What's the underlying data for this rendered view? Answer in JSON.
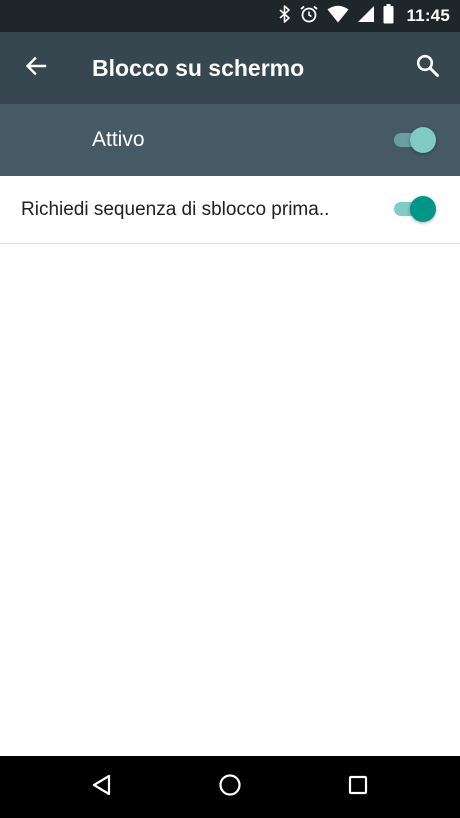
{
  "status_bar": {
    "time": "11:45",
    "icons": [
      "bluetooth-icon",
      "alarm-icon",
      "wifi-icon",
      "cell-signal-icon",
      "battery-icon"
    ]
  },
  "app_bar": {
    "title": "Blocco su schermo",
    "back_icon": "arrow-back-icon",
    "search_icon": "search-icon",
    "background": "#37474f"
  },
  "master_switch": {
    "label": "Attivo",
    "checked": true,
    "background": "#455a64"
  },
  "settings": {
    "items": [
      {
        "label": "Richiedi sequenza di sblocco prima..",
        "checked": true
      }
    ]
  },
  "nav_bar": {
    "buttons": [
      "back-triangle-icon",
      "home-circle-icon",
      "recents-square-icon"
    ]
  },
  "colors": {
    "accent": "#009688",
    "accent_light": "#80cbc4"
  }
}
